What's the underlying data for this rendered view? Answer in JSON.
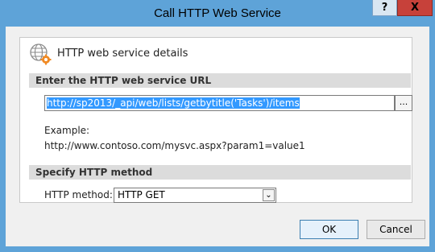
{
  "window": {
    "title": "Call HTTP Web Service",
    "help_label": "?",
    "close_label": "X"
  },
  "details": {
    "heading": "HTTP web service details"
  },
  "url_section": {
    "header": "Enter the HTTP web service URL",
    "url_value": "http://sp2013/_api/web/lists/getbytitle('Tasks')/items",
    "browse_label": "...",
    "example_label": "Example:",
    "example_value": "http://www.contoso.com/mysvc.aspx?param1=value1"
  },
  "method_section": {
    "header": "Specify HTTP method",
    "label": "HTTP method:",
    "selected": "HTTP GET"
  },
  "footer": {
    "ok_label": "OK",
    "cancel_label": "Cancel"
  },
  "icons": {
    "globe": "globe-gear-icon",
    "dropdown": "chevron-down-icon"
  },
  "colors": {
    "frame": "#5ea3d8",
    "close": "#c7413a",
    "selection": "#3399ff"
  }
}
